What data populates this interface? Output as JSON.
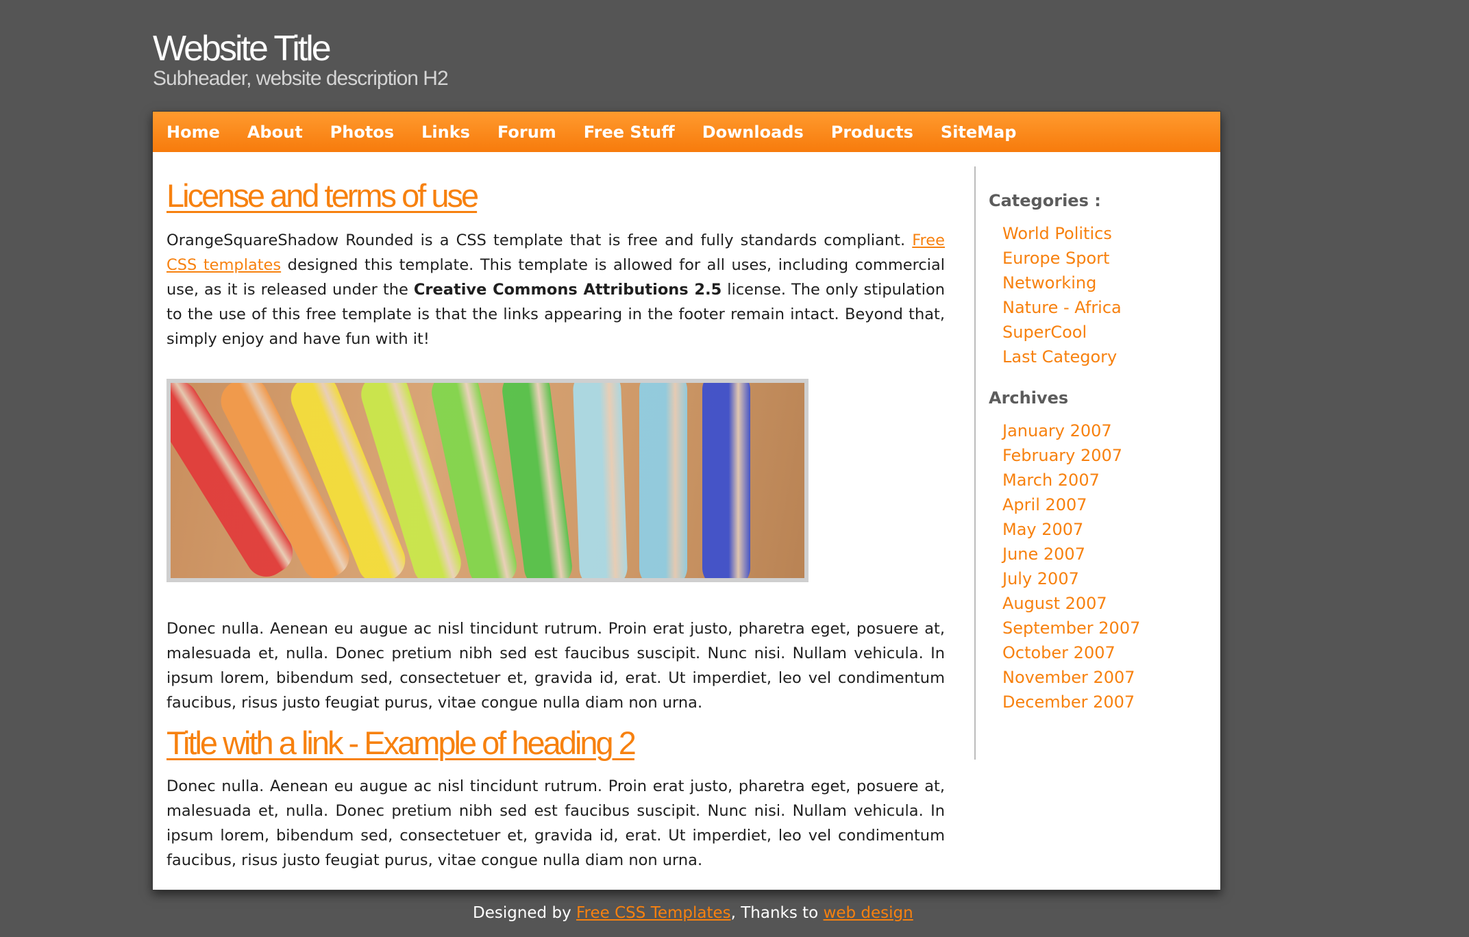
{
  "header": {
    "title": "Website Title",
    "subtitle": "Subheader, website description H2"
  },
  "menu": [
    {
      "label": "Home"
    },
    {
      "label": "About"
    },
    {
      "label": "Photos"
    },
    {
      "label": "Links"
    },
    {
      "label": "Forum"
    },
    {
      "label": "Free Stuff"
    },
    {
      "label": "Downloads"
    },
    {
      "label": "Products"
    },
    {
      "label": "SiteMap"
    }
  ],
  "content": {
    "heading1": "License and terms of use",
    "intro": {
      "text_before_link": "OrangeSquareShadow Rounded is a CSS template that is free and fully standards compliant. ",
      "link": "Free CSS templates",
      "text_after_link": " designed this template. This template is allowed for all uses, including commercial use, as it is released under the ",
      "bold": "Creative Commons Attributions 2.5",
      "text_end": " license. The only stipulation to the use of this free template is that the links appearing in the footer remain intact. Beyond that, simply enjoy and have fun with it!"
    },
    "paragraph2": "Donec nulla. Aenean eu augue ac nisl tincidunt rutrum. Proin erat justo, pharetra eget, posuere at, malesuada et, nulla. Donec pretium nibh sed est faucibus suscipit. Nunc nisi. Nullam vehicula. In ipsum lorem, bibendum sed, consectetuer et, gravida id, erat. Ut imperdiet, leo vel condimentum faucibus, risus justo feugiat purus, vitae congue nulla diam non urna.",
    "heading2": "Title with a link - Example of heading 2",
    "paragraph3": "Donec nulla. Aenean eu augue ac nisl tincidunt rutrum. Proin erat justo, pharetra eget, posuere at, malesuada et, nulla. Donec pretium nibh sed est faucibus suscipit. Nunc nisi. Nullam vehicula. In ipsum lorem, bibendum sed, consectetuer et, gravida id, erat. Ut imperdiet, leo vel condimentum faucibus, risus justo feugiat purus, vitae congue nulla diam non urna."
  },
  "sidebar": {
    "categories_heading": "Categories :",
    "categories": [
      "World Politics",
      "Europe Sport",
      "Networking",
      "Nature - Africa",
      "SuperCool",
      "Last Category"
    ],
    "archives_heading": "Archives",
    "archives": [
      "January 2007",
      "February 2007",
      "March 2007",
      "April 2007",
      "May 2007",
      "June 2007",
      "July 2007",
      "August 2007",
      "September 2007",
      "October 2007",
      "November 2007",
      "December 2007"
    ]
  },
  "footer": {
    "text1": "Designed by ",
    "link1": "Free CSS Templates",
    "text2": ", Thanks to ",
    "link2": "web design"
  },
  "colors": {
    "accent": "#f7810f",
    "background": "#555555",
    "marker_colors": [
      "#e23a3a",
      "#f39a4a",
      "#f5e03a",
      "#c9ea4a",
      "#7fd84c",
      "#52c44a",
      "#a9dcea",
      "#8ecfe6",
      "#3a4fd0"
    ]
  }
}
